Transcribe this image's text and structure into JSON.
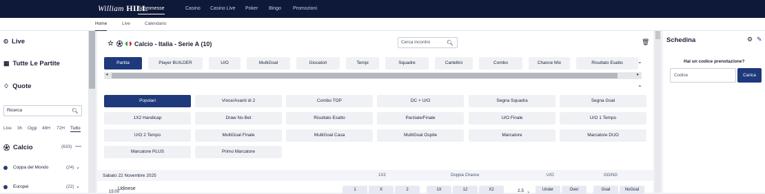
{
  "brand": {
    "logo_main": "William",
    "logo_sub": "HILL"
  },
  "main_nav": [
    "Scommesse",
    "Casino",
    "Casino Live",
    "Poker",
    "Bingo",
    "Promozioni"
  ],
  "sub_nav": [
    "Home",
    "Live",
    "Calendario"
  ],
  "sidebar": {
    "live": "Live",
    "all_matches": "Tutte Le Partite",
    "quotes": "Quote",
    "search_placeholder": "Ricerca",
    "time_filters": [
      "Live",
      "3h",
      "Oggi",
      "48H",
      "72H",
      "Tutto"
    ],
    "sport": {
      "label": "Calcio",
      "count": "(633)"
    },
    "categories": [
      {
        "label": "Coppa del Mondo",
        "count": "(24)"
      },
      {
        "label": "Europei",
        "count": "(22)"
      }
    ]
  },
  "main": {
    "title": "Calcio - Italia - Serie A (10)",
    "search_placeholder": "Cerca incontro",
    "tabs": [
      "Partita",
      "Player BUILDER",
      "U/O",
      "MultiGoal",
      "Giocatori",
      "Tempi",
      "Squadre",
      "Cartellini",
      "Combo",
      "Chance Mix",
      "Risultato Esatto"
    ],
    "markets": [
      "Popolari",
      "Vince/Avanti di 2",
      "Combo TOP",
      "DC + U/O",
      "Segna Squadra",
      "Segna Goal",
      "1X2 Handicap",
      "Draw No Bet",
      "Risultato Esatto",
      "Parziale/Finale",
      "U/O Finale",
      "U/O 1 Tempo",
      "U/O 2 Tempo",
      "MultiGoal Finale",
      "MultiGoal Casa",
      "MultiGoal Ospite",
      "Marcatore",
      "Marcatore DUO",
      "Marcatore PLUS",
      "Primo Marcatore"
    ],
    "event_header": {
      "date": "Sabato 22 Novembre 2025",
      "col_1x2": "1X2",
      "col_dc": "Doppia Chance",
      "col_uo": "U/O",
      "col_gg": "GG/NG"
    },
    "event": {
      "team": "Udinese",
      "time": "15:00",
      "odds_1x2": [
        "1",
        "X",
        "2"
      ],
      "odds_dc": [
        "1X",
        "12",
        "X2"
      ],
      "uo_line": "2.5",
      "odds_uo": [
        "Under",
        "Over"
      ],
      "odds_gg": [
        "Goal",
        "NoGoal"
      ]
    }
  },
  "betslip": {
    "title": "Schedina",
    "question": "Hai un codice prenotazione?",
    "code_placeholder": "Codice",
    "load_button": "Carica"
  },
  "colors": {
    "navy": "#0e1838",
    "accent": "#1e3a7c"
  }
}
